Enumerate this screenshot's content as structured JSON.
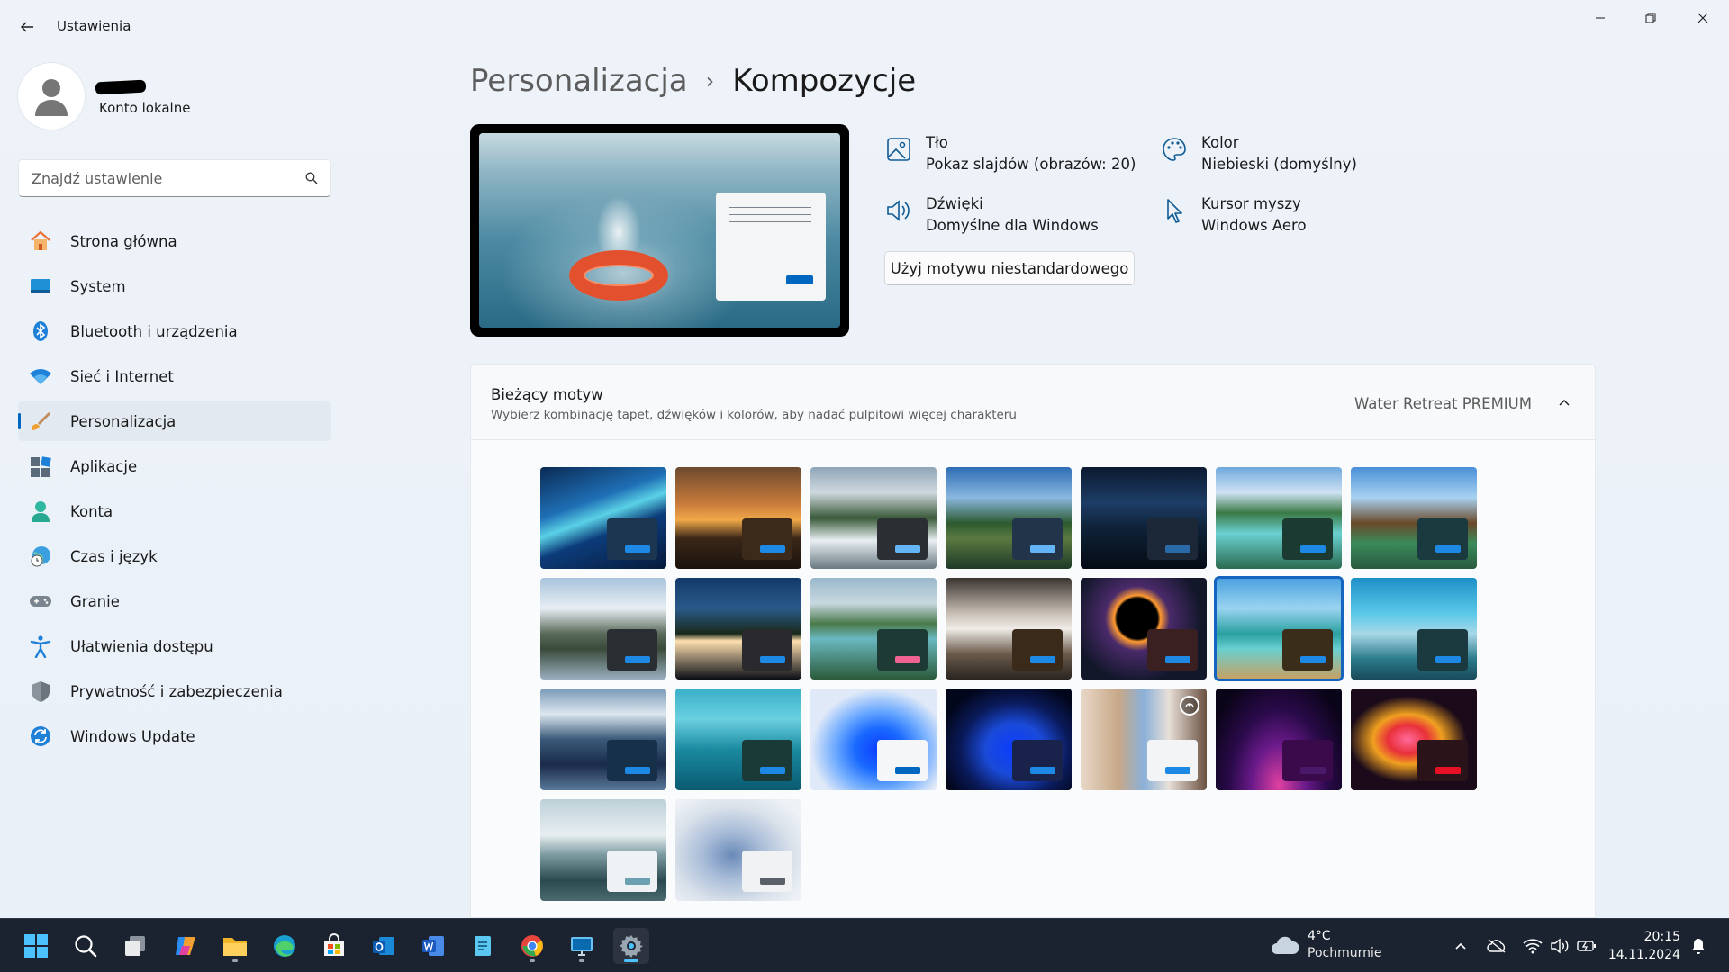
{
  "window": {
    "title": "Ustawienia"
  },
  "account": {
    "type": "Konto lokalne"
  },
  "search": {
    "placeholder": "Znajdź ustawienie"
  },
  "sidebar": {
    "items": [
      {
        "label": "Strona główna",
        "icon": "home-icon"
      },
      {
        "label": "System",
        "icon": "system-icon"
      },
      {
        "label": "Bluetooth i urządzenia",
        "icon": "bluetooth-icon"
      },
      {
        "label": "Sieć i Internet",
        "icon": "wifi-icon"
      },
      {
        "label": "Personalizacja",
        "icon": "brush-icon",
        "active": true
      },
      {
        "label": "Aplikacje",
        "icon": "apps-icon"
      },
      {
        "label": "Konta",
        "icon": "person-icon"
      },
      {
        "label": "Czas i język",
        "icon": "globe-clock-icon"
      },
      {
        "label": "Granie",
        "icon": "gamepad-icon"
      },
      {
        "label": "Ułatwienia dostępu",
        "icon": "accessibility-icon"
      },
      {
        "label": "Prywatność i zabezpieczenia",
        "icon": "shield-icon"
      },
      {
        "label": "Windows Update",
        "icon": "update-icon"
      }
    ]
  },
  "breadcrumb": {
    "parent": "Personalizacja",
    "separator": "›",
    "current": "Kompozycje"
  },
  "properties": {
    "background": {
      "title": "Tło",
      "value": "Pokaz slajdów (obrazów: 20)"
    },
    "color": {
      "title": "Kolor",
      "value": "Niebieski (domyślny)"
    },
    "sounds": {
      "title": "Dźwięki",
      "value": "Domyślne dla Windows"
    },
    "cursor": {
      "title": "Kursor myszy",
      "value": "Windows Aero"
    }
  },
  "custom_theme_button": "Użyj motywu niestandardowego",
  "current_theme": {
    "title": "Bieżący motyw",
    "subtitle": "Wybierz kombinację tapet, dźwięków i kolorów, aby nadać pulpitowi więcej charakteru",
    "selected_name": "Water Retreat PREMIUM"
  },
  "themes": [
    {
      "bg": "linear-gradient(160deg,#0a2a55 0%,#1f6fb5 35%,#5ad1e6 48%,#0c3c7a 62%,#061a3a 100%)",
      "panel": "#1c3550",
      "btn": "#1e88e5"
    },
    {
      "bg": "linear-gradient(180deg,#6d4a2e 0%,#c6793a 35%,#f0a848 52%,#3a2618 70%,#1b130d 100%)",
      "panel": "#3b2a1a",
      "btn": "#1e88e5"
    },
    {
      "bg": "linear-gradient(180deg,#8fa6b8 0%,#cfd8de 25%,#3a5a3a 50%,#e8eef2 72%,#6a7a82 100%)",
      "panel": "#2b2f33",
      "btn": "#64b5f6"
    },
    {
      "bg": "linear-gradient(180deg,#2e6db5 0%,#8ab8e0 30%,#2d5a30 55%,#5a7a40 70%,#1e3a28 100%)",
      "panel": "#22344a",
      "btn": "#64b5f6"
    },
    {
      "bg": "linear-gradient(180deg,#0b1a30 0%,#1e3d66 35%,#0e2238 60%,#050b14 100%)",
      "panel": "#1c2838",
      "btn": "#2b6aa8"
    },
    {
      "bg": "linear-gradient(180deg,#6fa8dc 0%,#cfe2f3 25%,#3a7a46 45%,#6ad0d0 65%,#2a6a50 100%)",
      "panel": "#1b3b32",
      "btn": "#1e88e5"
    },
    {
      "bg": "linear-gradient(180deg,#4a8fd8 0%,#a8d2f0 30%,#6a4a2a 55%,#3a8a5a 75%,#2a5a40 100%)",
      "panel": "#1a3a40",
      "btn": "#1e88e5"
    },
    {
      "bg": "linear-gradient(180deg,#a8c4dc 0%,#e8eef4 30%,#5a6a5a 55%,#3a4a3a 70%,#9ab0c0 100%)",
      "panel": "#2a2e32",
      "btn": "#1e88e5"
    },
    {
      "bg": "linear-gradient(180deg,#123a6a 0%,#2a5a8a 30%,#1a2a1a 55%,#ffe0b0 62%,#0a0e14 100%)",
      "panel": "#2a2a2e",
      "btn": "#1e88e5"
    },
    {
      "bg": "linear-gradient(180deg,#9ab8cc 0%,#c8d8e0 25%,#4a7a4a 45%,#6ab8c0 60%,#2a5a3a 100%)",
      "panel": "#1e3a34",
      "btn": "#f06292"
    },
    {
      "bg": "linear-gradient(180deg,#3a3430 0%,#c8beb4 35%,#f0ece8 50%,#6a5a4a 75%,#2a2420 100%)",
      "panel": "#3a2a1a",
      "btn": "#1e88e5"
    },
    {
      "bg": "radial-gradient(circle at 45% 40%,#000 22%,#ff9a30 25%,#4a2a6a 35%,#12172a 70%)",
      "panel": "#3a2020",
      "btn": "#1e88e5"
    },
    {
      "bg": "linear-gradient(180deg,#4aa0e0 0%,#9ad4f0 30%,#2aa0a0 55%,#6ad0d0 70%,#c8a060 100%)",
      "panel": "#3a2e1a",
      "btn": "#1e88e5"
    },
    {
      "bg": "linear-gradient(180deg,#1e90c8 0%,#5ac8e8 35%,#a8d8e8 55%,#2a7a8a 80%,#1a4a5a 100%)",
      "panel": "#1a3a40",
      "btn": "#1e88e5"
    },
    {
      "bg": "linear-gradient(180deg,#7a9ab8 0%,#dce6ee 25%,#3a5a7a 50%,#1a2a4a 75%,#5a7a9a 100%)",
      "panel": "#16304a",
      "btn": "#1e88e5"
    },
    {
      "bg": "linear-gradient(180deg,#3ab0c8 0%,#6ad0e0 30%,#1a8aa0 60%,#0a5a70 100%)",
      "panel": "#1a3a38",
      "btn": "#1e88e5"
    },
    {
      "bg": "radial-gradient(ellipse at 55% 60%,#0a3cff 0%,#1a6aff 25%,#6aa8ff 45%,#dfe9f8 70%)",
      "panel": "#f4f6f8",
      "btn": "#0067c0"
    },
    {
      "bg": "radial-gradient(ellipse at 55% 60%,#0a3cff 0%,#1a4ad8 30%,#0a1a5a 55%,#02061a 80%)",
      "panel": "#18224a",
      "btn": "#1e88e5"
    },
    {
      "bg": "linear-gradient(90deg,#e8d8c8 0%,#c8a888 30%,#8ab0d8 50%,#e8e0d8 70%,#6a5040 100%)",
      "panel": "#f2f4f6",
      "btn": "#1e88e5",
      "badge": true
    },
    {
      "bg": "radial-gradient(ellipse at 50% 95%,#e040a0 0%,#6a1a8a 30%,#2a0a4a 55%,#0a0418 85%)",
      "panel": "#3a0a4a",
      "btn": "#4a1a6a"
    },
    {
      "bg": "radial-gradient(ellipse at 45% 50%,#ff6a9a 0%,#e8303a 20%,#f0a020 35%,#1a0a1a 60%)",
      "panel": "#2a141a",
      "btn": "#e81123"
    },
    {
      "bg": "linear-gradient(180deg,#bcd0d8 0%,#e8eef0 35%,#7a9aa0 55%,#2a4a50 80%,#4a6a70 100%)",
      "panel": "#eef2f4",
      "btn": "#6aa0b0"
    },
    {
      "bg": "radial-gradient(ellipse at 45% 55%,#6a8ab8 0%,#a8bcd8 30%,#d8e0ea 60%,#eef2f6 85%)",
      "panel": "#f0f2f4",
      "btn": "#5a6068"
    }
  ],
  "selected_theme_index": 12,
  "weather": {
    "temp": "4°C",
    "desc": "Pochmurnie"
  },
  "clock": {
    "time": "20:15",
    "date": "14.11.2024"
  }
}
